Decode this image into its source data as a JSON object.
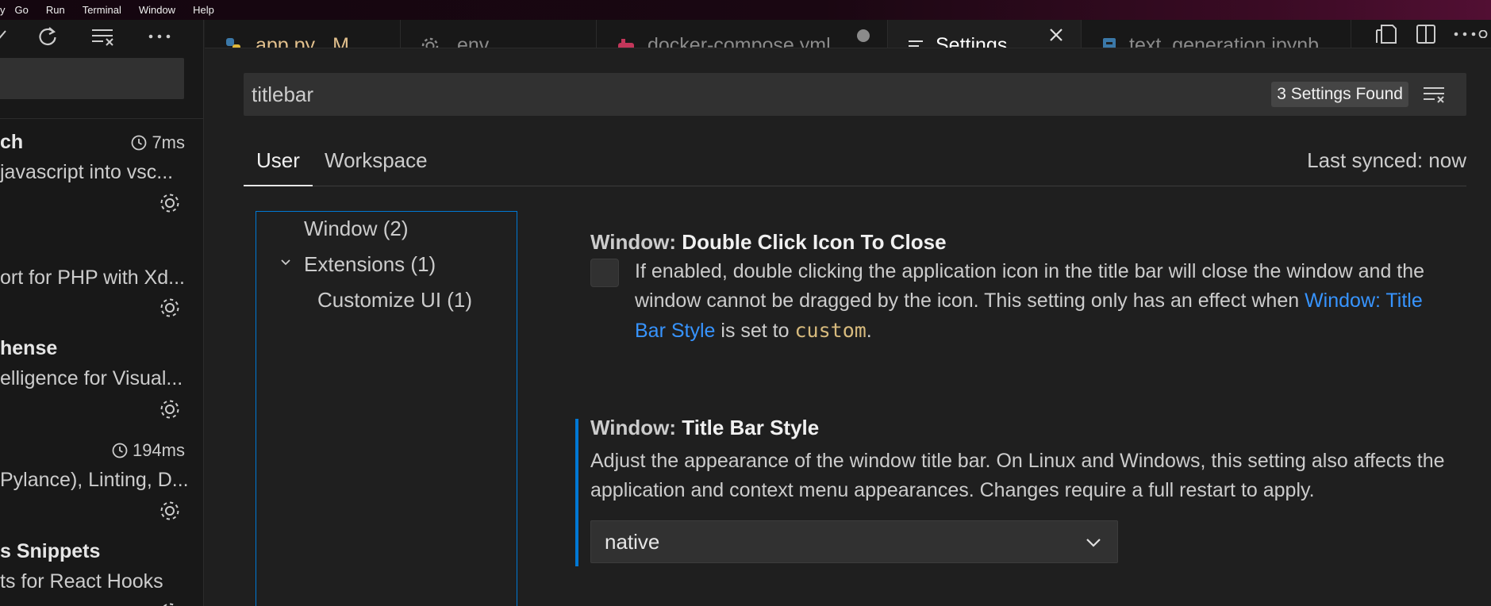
{
  "menubar": {
    "items": [
      "y",
      "Go",
      "Run",
      "Terminal",
      "Window",
      "Help"
    ]
  },
  "sidebar": {
    "extensions": [
      {
        "name": "ch",
        "time": "7ms",
        "desc": "javascript into vsc...",
        "sub": ""
      },
      {
        "name": "",
        "time": "",
        "desc": "ort for PHP with Xd...",
        "sub": ""
      },
      {
        "name": "hense",
        "time": "",
        "desc": "elligence for Visual...",
        "sub": ""
      },
      {
        "name": "",
        "time": "194ms",
        "desc": "Pylance), Linting, D...",
        "sub": ""
      },
      {
        "name": "s Snippets",
        "time": "",
        "desc": "ts for React Hooks",
        "sub": ""
      }
    ]
  },
  "tabs": [
    {
      "label": "app.py",
      "badge": "M",
      "color": "#e2c08d",
      "icon": "python-icon"
    },
    {
      "label": ".env",
      "badge": "",
      "color": "#8b8b8b",
      "icon": "gear-icon"
    },
    {
      "label": "docker-compose.yml",
      "badge": "",
      "color": "#8b8b8b",
      "icon": "docker-icon"
    },
    {
      "label": "Settings",
      "badge": "",
      "color": "#ffffff",
      "icon": "settings-list-icon"
    },
    {
      "label": "text_generation.ipynb",
      "badge": "",
      "color": "#8b8b8b",
      "icon": "notebook-icon"
    }
  ],
  "settings": {
    "search_value": "titlebar",
    "found": "3 Settings Found",
    "scope_tabs": [
      "User",
      "Workspace"
    ],
    "last_synced": "Last synced: now",
    "toc": {
      "window": "Window (2)",
      "extensions": "Extensions (1)",
      "customize_ui": "Customize UI (1)"
    },
    "s1": {
      "category": "Window: ",
      "key": "Double Click Icon To Close",
      "desc_a": "If enabled, double clicking the application icon in the title bar will close the window and the window cannot be dragged by the icon. This setting only has an effect when ",
      "link": "Window: Title Bar Style",
      "desc_b": " is set to ",
      "code": "custom",
      "desc_c": "."
    },
    "s2": {
      "category": "Window: ",
      "key": "Title Bar Style",
      "desc": "Adjust the appearance of the window title bar. On Linux and Windows, this setting also affects the application and context menu appearances. Changes require a full restart to apply.",
      "value": "native"
    }
  },
  "colors": {
    "accent": "#0078d4",
    "link": "#3794ff",
    "code": "#d7ba7d",
    "modified_tab": "#e2c08d"
  }
}
